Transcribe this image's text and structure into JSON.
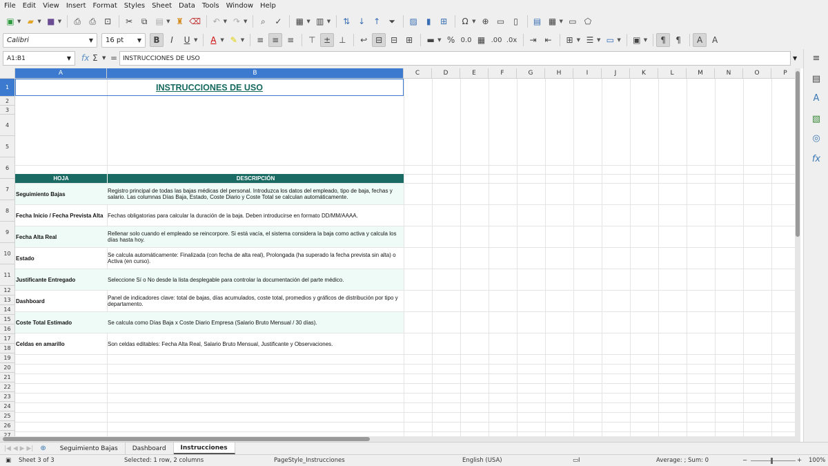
{
  "menu": [
    "File",
    "Edit",
    "View",
    "Insert",
    "Format",
    "Styles",
    "Sheet",
    "Data",
    "Tools",
    "Window",
    "Help"
  ],
  "font": {
    "name": "Calibri",
    "size": "16 pt"
  },
  "formula": {
    "namebox": "A1:B1",
    "content": "INSTRUCCIONES DE USO"
  },
  "columns": [
    "A",
    "B",
    "C",
    "D",
    "E",
    "F",
    "G",
    "H",
    "I",
    "J",
    "K",
    "L",
    "M",
    "N",
    "O",
    "P"
  ],
  "rows": [
    "1",
    "2",
    "3",
    "4",
    "5",
    "6",
    "7",
    "8",
    "9",
    "10",
    "11",
    "12",
    "13",
    "14",
    "15",
    "16",
    "17",
    "18",
    "19",
    "20",
    "21",
    "22",
    "23",
    "24",
    "25",
    "26",
    "27"
  ],
  "sheet": {
    "title": "INSTRUCCIONES DE USO",
    "header_hoja": "HOJA",
    "header_desc": "DESCRIPCIÓN",
    "items": [
      {
        "name": "Seguimiento Bajas",
        "desc": "Registro principal de todas las bajas médicas del personal. Introduzca los datos del empleado, tipo de baja, fechas y salario. Las columnas Días Baja, Estado, Coste Diario y Coste Total se calculan automáticamente."
      },
      {
        "name": "Fecha Inicio / Fecha Prevista Alta",
        "desc": "Fechas obligatorias para calcular la duración de la baja. Deben introducirse en formato DD/MM/AAAA."
      },
      {
        "name": "Fecha Alta Real",
        "desc": "Rellenar solo cuando el empleado se reincorpore. Si está vacía, el sistema considera la baja como activa y calcula los días hasta hoy."
      },
      {
        "name": "Estado",
        "desc": "Se calcula automáticamente: Finalizada (con fecha de alta real), Prolongada (ha superado la fecha prevista sin alta) o Activa (en curso)."
      },
      {
        "name": "Justificante Entregado",
        "desc": "Seleccione Sí o No desde la lista desplegable para controlar la documentación del parte médico."
      },
      {
        "name": "Dashboard",
        "desc": "Panel de indicadores clave: total de bajas, días acumulados, coste total, promedios y gráficos de distribución por tipo y departamento."
      },
      {
        "name": "Coste Total Estimado",
        "desc": "Se calcula como Días Baja x Coste Diario Empresa (Salario Bruto Mensual / 30 días)."
      },
      {
        "name": "Celdas en amarillo",
        "desc": "Son celdas editables: Fecha Alta Real, Salario Bruto Mensual, Justificante y Observaciones."
      }
    ]
  },
  "tabs": [
    "Seguimiento Bajas",
    "Dashboard",
    "Instrucciones"
  ],
  "active_tab": "Instrucciones",
  "status": {
    "sheet": "Sheet 3 of 3",
    "selected": "Selected: 1 row, 2 columns",
    "pagestyle": "PageStyle_Instrucciones",
    "language": "English (USA)",
    "sum": "Average: ; Sum: 0",
    "zoom": "100%"
  },
  "colors": {
    "header_bg": "#1a6b63",
    "title_text": "#16695f",
    "band": "#eefbf7",
    "selection": "#3c7ad0"
  }
}
